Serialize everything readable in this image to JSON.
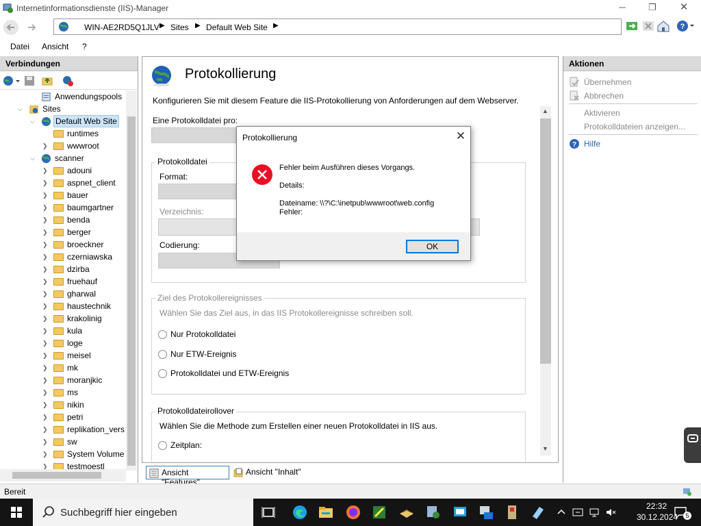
{
  "window": {
    "title": "Internetinformationsdienste (IIS)-Manager",
    "minimize": "─",
    "maximize": "❐",
    "close": "✕"
  },
  "address": {
    "crumbs": [
      "WIN-AE2RD5Q1JLV",
      "Sites",
      "Default Web Site"
    ],
    "sep": "▶"
  },
  "menu": [
    "Datei",
    "Ansicht",
    "?"
  ],
  "connections": {
    "header": "Verbindungen",
    "tree": [
      {
        "label": "Anwendungspools",
        "icon": "app-pool",
        "level": 2,
        "expand": ""
      },
      {
        "label": "Sites",
        "icon": "sites",
        "level": 1,
        "expand": "open"
      },
      {
        "label": "Default Web Site",
        "icon": "globe",
        "level": 2,
        "expand": "open",
        "selected": true
      },
      {
        "label": "runtimes",
        "icon": "folder",
        "level": 3,
        "expand": ""
      },
      {
        "label": "wwwroot",
        "icon": "folder",
        "level": 3,
        "expand": "closed"
      },
      {
        "label": "scanner",
        "icon": "globe",
        "level": 2,
        "expand": "open"
      },
      {
        "label": "adouni",
        "icon": "folder",
        "level": 3,
        "expand": "closed"
      },
      {
        "label": "aspnet_client",
        "icon": "folder",
        "level": 3,
        "expand": "closed"
      },
      {
        "label": "bauer",
        "icon": "folder",
        "level": 3,
        "expand": "closed"
      },
      {
        "label": "baumgartner",
        "icon": "folder",
        "level": 3,
        "expand": "closed"
      },
      {
        "label": "benda",
        "icon": "folder",
        "level": 3,
        "expand": "closed"
      },
      {
        "label": "berger",
        "icon": "folder",
        "level": 3,
        "expand": "closed"
      },
      {
        "label": "broeckner",
        "icon": "folder",
        "level": 3,
        "expand": "closed"
      },
      {
        "label": "czerniawska",
        "icon": "folder",
        "level": 3,
        "expand": "closed"
      },
      {
        "label": "dzirba",
        "icon": "folder",
        "level": 3,
        "expand": "closed"
      },
      {
        "label": "fruehauf",
        "icon": "folder",
        "level": 3,
        "expand": "closed"
      },
      {
        "label": "gharwal",
        "icon": "folder",
        "level": 3,
        "expand": "closed"
      },
      {
        "label": "haustechnik",
        "icon": "folder",
        "level": 3,
        "expand": "closed"
      },
      {
        "label": "krakolinig",
        "icon": "folder",
        "level": 3,
        "expand": "closed"
      },
      {
        "label": "kula",
        "icon": "folder",
        "level": 3,
        "expand": "closed"
      },
      {
        "label": "loge",
        "icon": "folder",
        "level": 3,
        "expand": "closed"
      },
      {
        "label": "meisel",
        "icon": "folder",
        "level": 3,
        "expand": "closed"
      },
      {
        "label": "mk",
        "icon": "folder",
        "level": 3,
        "expand": "closed"
      },
      {
        "label": "moranjkic",
        "icon": "folder",
        "level": 3,
        "expand": "closed"
      },
      {
        "label": "ms",
        "icon": "folder",
        "level": 3,
        "expand": "closed"
      },
      {
        "label": "nikin",
        "icon": "folder",
        "level": 3,
        "expand": "closed"
      },
      {
        "label": "petri",
        "icon": "folder",
        "level": 3,
        "expand": "closed"
      },
      {
        "label": "replikation_vers",
        "icon": "folder",
        "level": 3,
        "expand": "closed"
      },
      {
        "label": "sw",
        "icon": "folder",
        "level": 3,
        "expand": "closed"
      },
      {
        "label": "System Volume",
        "icon": "folder",
        "level": 3,
        "expand": "closed"
      },
      {
        "label": "testmoestl",
        "icon": "folder",
        "level": 3,
        "expand": "closed"
      }
    ]
  },
  "feature": {
    "title": "Protokollierung",
    "description": "Konfigurieren Sie mit diesem Feature die IIS-Protokollierung von Anforderungen auf dem Webserver.",
    "per_file_label": "Eine Protokolldatei pro:",
    "logfile_group": "Protokolldatei",
    "format_label": "Format:",
    "directory_label": "Verzeichnis:",
    "encoding_label": "Codierung:",
    "target_group": "Ziel des Protokollereignisses",
    "target_desc": "Wählen Sie das Ziel aus, in das IIS Protokollereignisse schreiben soll.",
    "target_options": [
      "Nur Protokolldatei",
      "Nur ETW-Ereignis",
      "Protokolldatei und ETW-Ereignis"
    ],
    "rollover_group": "Protokolldateirollover",
    "rollover_desc": "Wählen Sie die Methode zum Erstellen einer neuen Protokolldatei in IIS aus.",
    "schedule_label": "Zeitplan:"
  },
  "view_tabs": [
    "Ansicht \"Features\"",
    "Ansicht \"Inhalt\""
  ],
  "actions": {
    "header": "Aktionen",
    "apply": "Übernehmen",
    "cancel": "Abbrechen",
    "activate": "Aktivieren",
    "show_logs": "Protokolldateien anzeigen...",
    "help": "Hilfe"
  },
  "status": "Bereit",
  "dialog": {
    "title": "Protokollierung",
    "message": "Fehler beim Ausführen dieses Vorgangs.",
    "details": "Details:",
    "filename": "Dateiname: \\\\?\\C:\\inetpub\\wwwroot\\web.config",
    "error": "Fehler:",
    "ok": "OK"
  },
  "taskbar": {
    "search_placeholder": "Suchbegriff hier eingeben",
    "time": "22:32",
    "date": "30.12.2024",
    "notifications": "5"
  },
  "colors": {
    "accent": "#0078d7",
    "error": "#e81123",
    "folder": "#f4c862"
  }
}
